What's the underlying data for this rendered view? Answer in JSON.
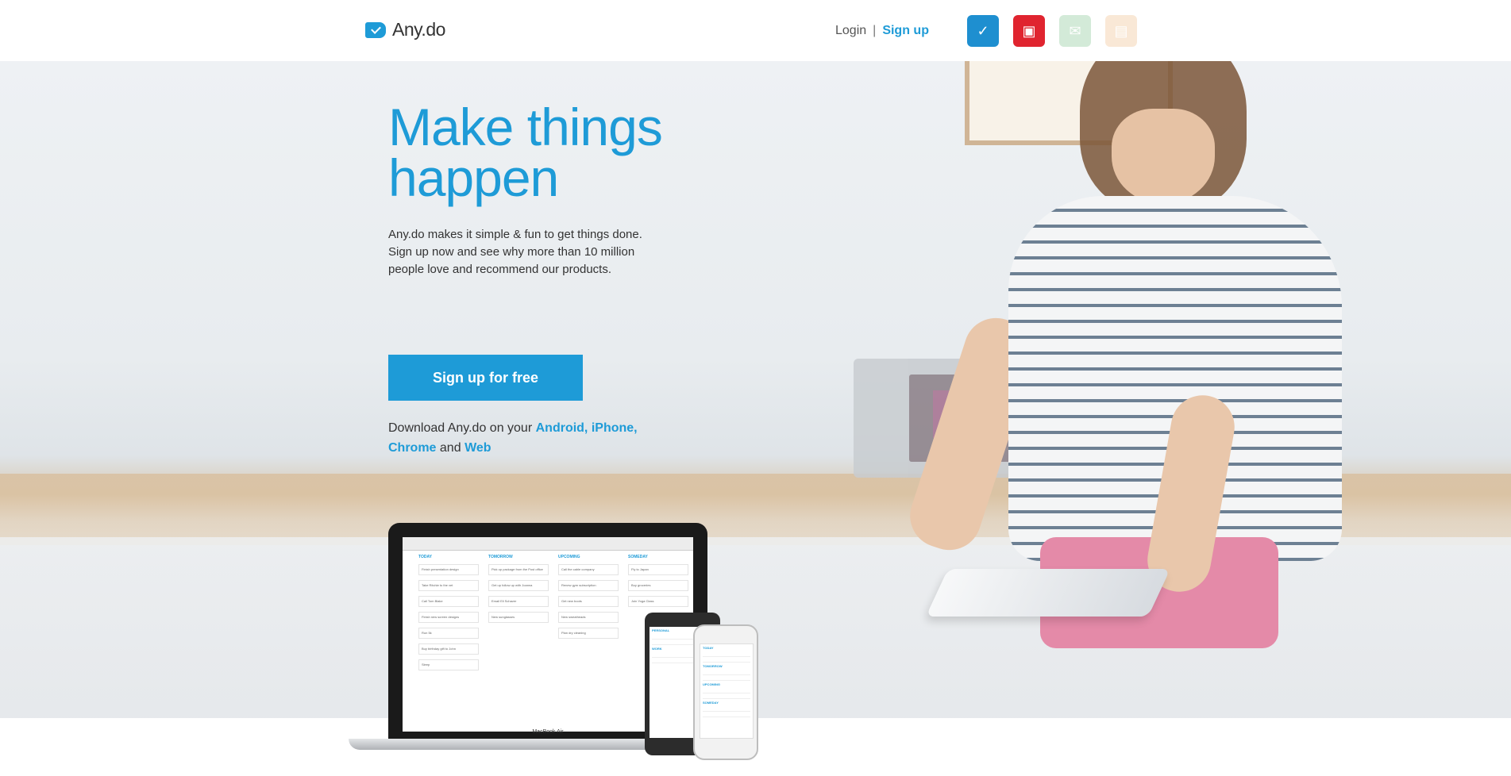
{
  "header": {
    "logo_text": "Any.do",
    "login_label": "Login",
    "separator": "|",
    "signup_label": "Sign up",
    "apps": [
      {
        "name": "todo-app-icon",
        "color": "#1e8fd0",
        "glyph": "✓"
      },
      {
        "name": "calendar-app-icon",
        "color": "#e0242f",
        "glyph": "▣"
      },
      {
        "name": "mail-app-icon",
        "color": "#cfe8d4",
        "glyph": "✉"
      },
      {
        "name": "notes-app-icon",
        "color": "#f9e6d2",
        "glyph": "▤"
      }
    ]
  },
  "hero": {
    "headline_line1": "Make things",
    "headline_line2": "happen",
    "subtitle_line1": "Any.do makes it simple & fun to get things done.",
    "subtitle_line2": "Sign up now and see why more than 10 million",
    "subtitle_line3": "people love and recommend our products.",
    "cta_label": "Sign up for free",
    "download_prefix": "Download Any.do on your",
    "download_android": "Android,",
    "download_iphone": "iPhone,",
    "download_chrome": "Chrome",
    "download_and": "and",
    "download_web": "Web"
  },
  "devices": {
    "laptop_brand": "MacBook Air",
    "columns": [
      {
        "title": "TODAY",
        "tasks": [
          "Finish presentation design",
          "Take Ritchie to the vet",
          "Call Tom Blake",
          "Finish new screen designs",
          "Run 5k",
          "Buy birthday gift to John",
          "Sleep"
        ]
      },
      {
        "title": "TOMORROW",
        "tasks": [
          "Pick up package from the Post office",
          "Get up follow up with Joanna",
          "Email Eli Schaver",
          "New sunglasses"
        ]
      },
      {
        "title": "UPCOMING",
        "tasks": [
          "Call the cable company",
          "Renew gym subscription",
          "Get new boots",
          "New sweatheads",
          "Plan dry cleaning"
        ]
      },
      {
        "title": "SOMEDAY",
        "tasks": [
          "Fly to Japan",
          "Buy groceries",
          "Join Yoga Class"
        ]
      }
    ],
    "phone1_sections": [
      "PERSONAL",
      "WORK"
    ],
    "phone2_sections": [
      "TODAY",
      "TOMORROW",
      "UPCOMING",
      "SOMEDAY"
    ]
  }
}
